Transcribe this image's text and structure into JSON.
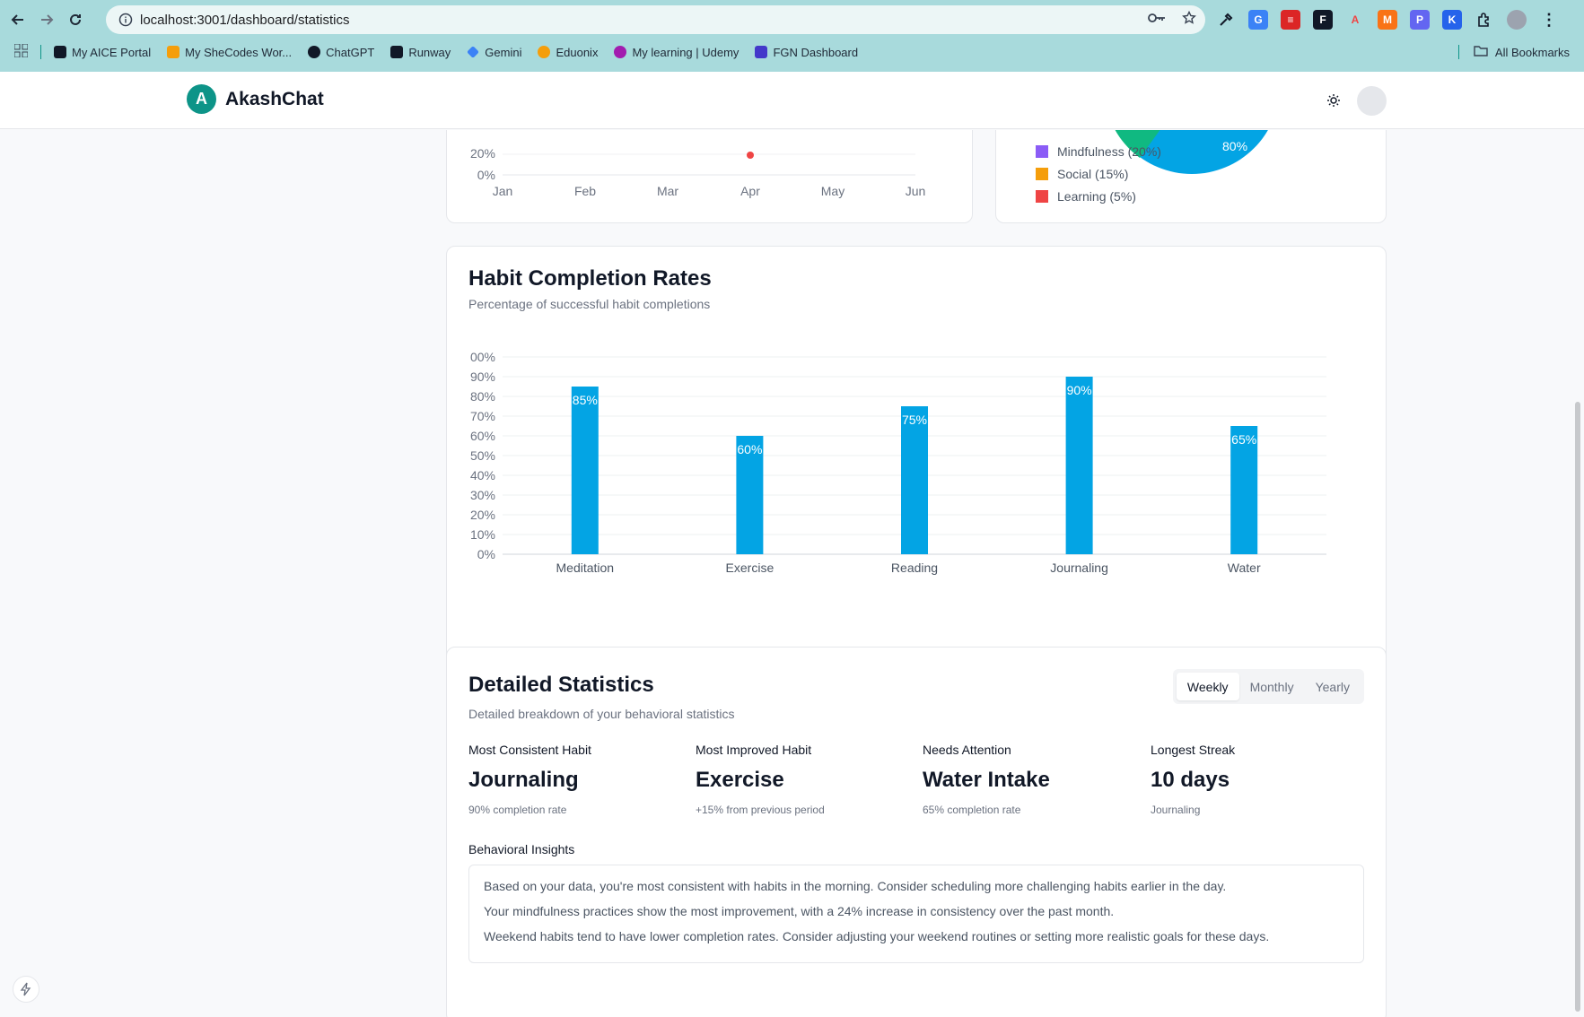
{
  "browser": {
    "url": "localhost:3001/dashboard/statistics",
    "bookmarks": [
      {
        "label": "My AICE Portal",
        "color": "#111827"
      },
      {
        "label": "My SheCodes Wor...",
        "color": "#f59e0b"
      },
      {
        "label": "ChatGPT",
        "color": "#111827"
      },
      {
        "label": "Runway",
        "color": "#111827"
      },
      {
        "label": "Gemini",
        "color": "#3b82f6"
      },
      {
        "label": "Eduonix",
        "color": "#f59e0b"
      },
      {
        "label": "My learning | Udemy",
        "color": "#a21caf"
      },
      {
        "label": "FGN Dashboard",
        "color": "#4338ca"
      }
    ],
    "all_bookmarks": "All Bookmarks"
  },
  "header": {
    "logo_letter": "A",
    "app_name": "AkashChat"
  },
  "trend_chart": {
    "x_labels": [
      "Jan",
      "Feb",
      "Mar",
      "Apr",
      "May",
      "Jun"
    ],
    "y_partial": "20%",
    "y_zero": "0%"
  },
  "category_legend": [
    {
      "label": "Mindfulness (20%)",
      "color": "#8b5cf6"
    },
    {
      "label": "Social (15%)",
      "color": "#f59e0b"
    },
    {
      "label": "Learning (5%)",
      "color": "#ef4444"
    }
  ],
  "pie_slice_label": "80%",
  "rates": {
    "title": "Habit Completion Rates",
    "subtitle": "Percentage of successful habit completions"
  },
  "chart_data": {
    "type": "bar",
    "categories": [
      "Meditation",
      "Exercise",
      "Reading",
      "Journaling",
      "Water"
    ],
    "values": [
      85,
      60,
      75,
      90,
      65
    ],
    "data_labels": [
      "85%",
      "60%",
      "75%",
      "90%",
      "65%"
    ],
    "y_ticks": [
      "0%",
      "10%",
      "20%",
      "30%",
      "40%",
      "50%",
      "60%",
      "70%",
      "80%",
      "90%",
      "00%"
    ],
    "ylim": [
      0,
      100
    ],
    "bar_color": "#03a4e4",
    "grid": true
  },
  "details": {
    "title": "Detailed Statistics",
    "subtitle": "Detailed breakdown of your behavioral statistics",
    "tabs": [
      {
        "label": "Weekly",
        "active": true
      },
      {
        "label": "Monthly",
        "active": false
      },
      {
        "label": "Yearly",
        "active": false
      }
    ],
    "stats": [
      {
        "label": "Most Consistent Habit",
        "value": "Journaling",
        "note": "90% completion rate"
      },
      {
        "label": "Most Improved Habit",
        "value": "Exercise",
        "note": "+15% from previous period"
      },
      {
        "label": "Needs Attention",
        "value": "Water Intake",
        "note": "65% completion rate"
      },
      {
        "label": "Longest Streak",
        "value": "10 days",
        "note": "Journaling"
      }
    ],
    "insights_label": "Behavioral Insights",
    "insights": [
      "Based on your data, you're most consistent with habits in the morning. Consider scheduling more challenging habits earlier in the day.",
      "Your mindfulness practices show the most improvement, with a 24% increase in consistency over the past month.",
      "Weekend habits tend to have lower completion rates. Consider adjusting your weekend routines or setting more realistic goals for these days."
    ]
  }
}
